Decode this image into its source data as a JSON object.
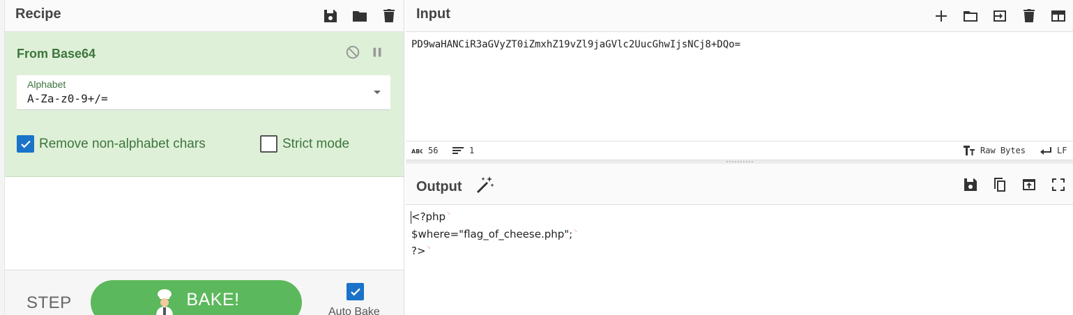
{
  "recipe": {
    "title": "Recipe",
    "header_icons": [
      "save-icon",
      "folder-icon",
      "trash-icon"
    ],
    "operation": {
      "name": "From Base64",
      "alphabet_label": "Alphabet",
      "alphabet_value": "A-Za-z0-9+/=",
      "options": [
        {
          "label": "Remove non-alphabet chars",
          "checked": true
        },
        {
          "label": "Strict mode",
          "checked": false
        }
      ]
    },
    "controls": {
      "step_label": "STEP",
      "bake_label": "BAKE!",
      "auto_bake_label": "Auto Bake",
      "auto_bake_checked": true
    }
  },
  "input": {
    "title": "Input",
    "header_icons": [
      "plus-icon",
      "folder-icon",
      "sign-in-icon",
      "trash-icon",
      "layout-icon"
    ],
    "text": "PD9waHANCiR3aGVyZT0iZmxhZ19vZl9jaGVlc2UucGhwIjsNCj8+DQo=",
    "status": {
      "char_count": "56",
      "line_count": "1",
      "encoding": "Raw Bytes",
      "eol": "LF"
    }
  },
  "output": {
    "title": "Output",
    "header_icons": [
      "magic-wand-icon",
      "save-icon",
      "copy-icon",
      "replace-input-icon",
      "maximise-icon"
    ],
    "lines": [
      "<?php",
      "$where=\"flag_of_cheese.php\";",
      "?>"
    ],
    "eol_marker": "␍"
  },
  "colors": {
    "operation_bg": "#dff0d8",
    "operation_text": "#3c763d",
    "bake_button": "#5cb85c",
    "checkbox": "#1a73c8",
    "crlf_marker": "#d9534f"
  }
}
